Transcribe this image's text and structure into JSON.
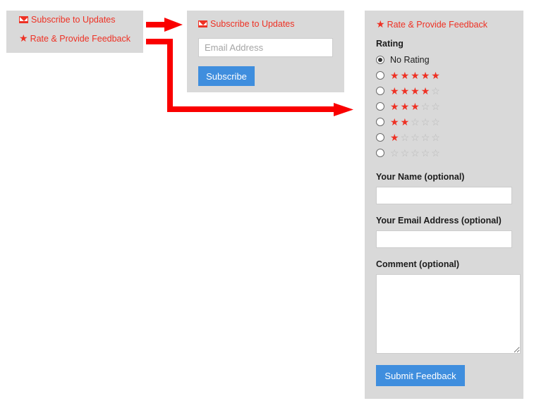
{
  "colors": {
    "panel_bg": "#d9d9d9",
    "link_red": "#ee3124",
    "star_on": "#ee3124",
    "star_off": "#b9b9b9",
    "button_blue": "#3f8ede",
    "arrow_red": "#fa0000",
    "page_bg": "#ffffff"
  },
  "source_panel": {
    "links": [
      {
        "icon": "envelope-icon",
        "label": "Subscribe to Updates"
      },
      {
        "icon": "star-icon",
        "label": "Rate & Provide Feedback"
      }
    ]
  },
  "subscribe_panel": {
    "icon": "envelope-icon",
    "heading": "Subscribe to Updates",
    "email_field": {
      "value": "",
      "placeholder": "Email Address"
    },
    "submit_label": "Subscribe"
  },
  "feedback_panel": {
    "icon": "star-icon",
    "heading": "Rate & Provide Feedback",
    "rating_label": "Rating",
    "rating_options": [
      {
        "label": "No Rating",
        "filled": 0,
        "total": 0,
        "selected": true
      },
      {
        "label": "5 stars",
        "filled": 5,
        "total": 5,
        "selected": false
      },
      {
        "label": "4 stars",
        "filled": 4,
        "total": 5,
        "selected": false
      },
      {
        "label": "3 stars",
        "filled": 3,
        "total": 5,
        "selected": false
      },
      {
        "label": "2 stars",
        "filled": 2,
        "total": 5,
        "selected": false
      },
      {
        "label": "1 star",
        "filled": 1,
        "total": 5,
        "selected": false
      },
      {
        "label": "0 stars",
        "filled": 0,
        "total": 5,
        "selected": false
      }
    ],
    "name_label": "Your Name (optional)",
    "name_value": "",
    "email_label": "Your Email Address (optional)",
    "email_value": "",
    "comment_label": "Comment (optional)",
    "comment_value": "",
    "submit_label": "Submit Feedback"
  },
  "arrows": [
    {
      "name": "arrow-to-subscribe-panel",
      "type": "straight"
    },
    {
      "name": "arrow-to-feedback-panel",
      "type": "elbow"
    }
  ]
}
